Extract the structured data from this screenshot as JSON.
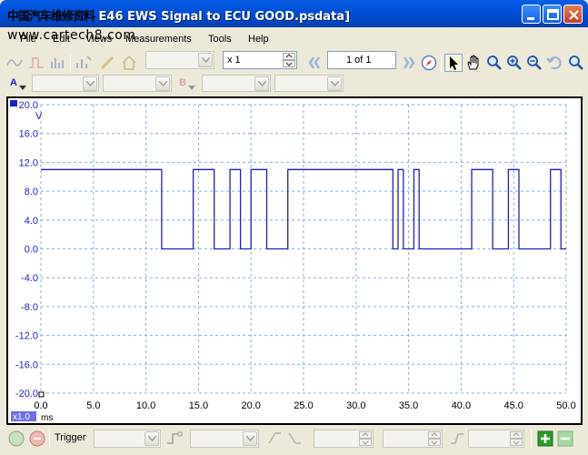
{
  "window": {
    "title_prefix_cn": "中国汽车维修资料",
    "title": "E46 EWS Signal to ECU GOOD.psdata]"
  },
  "watermark": "www.cartech8.com",
  "menu": {
    "file": "File",
    "edit": "Edit",
    "views": "Views",
    "measurements": "Measurements",
    "tools": "Tools",
    "help": "Help"
  },
  "toolbar": {
    "zoom_factor": "x 1",
    "page_indicator": "1 of 1",
    "channel_a_label": "A",
    "channel_b_label": "B"
  },
  "scope": {
    "y_unit": "V",
    "x_unit": "ms",
    "x_zoom_badge": "x1.0",
    "x_ticks": [
      "0.0",
      "5.0",
      "10.0",
      "15.0",
      "20.0",
      "25.0",
      "30.0",
      "35.0",
      "40.0",
      "45.0",
      "50.0"
    ],
    "y_ticks": [
      "20.0",
      "16.0",
      "12.0",
      "8.0",
      "4.0",
      "0.0",
      "-4.0",
      "-8.0",
      "-12.0",
      "-16.0",
      "-20.0"
    ],
    "trace_color": "#1E1EC8",
    "grid_color": "#7FB2E6"
  },
  "chart_data": {
    "type": "line",
    "xlabel": "ms",
    "ylabel": "V",
    "xlim": [
      0,
      50
    ],
    "ylim": [
      -20,
      20
    ],
    "grid": true,
    "series": [
      {
        "x": [
          0,
          11.5,
          11.5,
          14.5,
          14.5,
          16.5,
          16.5,
          18.0,
          18.0,
          19.0,
          19.0,
          20.0,
          20.0,
          21.5,
          21.5,
          23.5,
          23.5,
          33.5,
          33.5,
          34.0,
          34.0,
          34.5,
          34.5,
          35.5,
          35.5,
          36.0,
          36.0,
          41.0,
          41.0,
          43.0,
          43.0,
          44.5,
          44.5,
          45.5,
          45.5,
          48.5,
          48.5,
          49.5,
          49.5,
          50.0
        ],
        "y": [
          11,
          11,
          0,
          0,
          11,
          11,
          0,
          0,
          11,
          11,
          0,
          0,
          11,
          11,
          0,
          0,
          11,
          11,
          0,
          0,
          11,
          11,
          0,
          0,
          11,
          11,
          0,
          0,
          11,
          11,
          0,
          0,
          11,
          11,
          0,
          0,
          11,
          11,
          0,
          0
        ]
      }
    ]
  },
  "bottombar": {
    "trigger_label": "Trigger"
  },
  "colors": {
    "titlebar": "#0050D8",
    "face": "#ECE9D8"
  }
}
